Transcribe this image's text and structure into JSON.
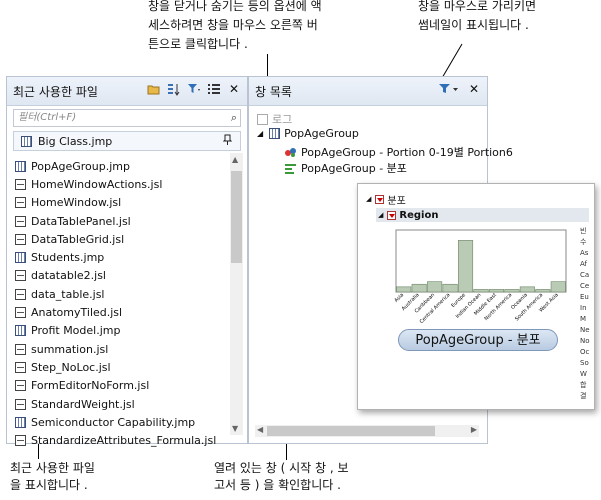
{
  "callouts": {
    "top_left": [
      "창을 닫거나 숨기는 등의 옵션에 액",
      "세스하려면 창을 마우스 오른쪽 버",
      "튼으로 클릭합니다 ."
    ],
    "top_right": [
      "창을 마우스로 가리키면",
      "썸네일이 표시됩니다 ."
    ],
    "bottom_left": [
      "최근 사용한 파일",
      "을 표시합니다 ."
    ],
    "bottom_right": [
      "열려 있는 창 ( 시작 창 , 보",
      "고서 등 ) 을 확인합니다 ."
    ]
  },
  "recent_files": {
    "title": "최근 사용한 파일",
    "header_icons": [
      "open-folder-icon",
      "sort-icon",
      "filter-icon",
      "list-view-icon",
      "close-icon"
    ],
    "filter_placeholder": "필터(Ctrl+F)",
    "pinned": {
      "name": "Big Class.jmp",
      "type": "jmp"
    },
    "files": [
      {
        "name": "PopAgeGroup.jmp",
        "type": "jmp"
      },
      {
        "name": "HomeWindowActions.jsl",
        "type": "jsl"
      },
      {
        "name": "HomeWindow.jsl",
        "type": "jsl"
      },
      {
        "name": "DataTablePanel.jsl",
        "type": "jsl"
      },
      {
        "name": "DataTableGrid.jsl",
        "type": "jsl"
      },
      {
        "name": "Students.jmp",
        "type": "jmp"
      },
      {
        "name": "datatable2.jsl",
        "type": "jsl"
      },
      {
        "name": "data_table.jsl",
        "type": "jsl"
      },
      {
        "name": "AnatomyTiled.jsl",
        "type": "jsl"
      },
      {
        "name": "Profit Model.jmp",
        "type": "jmp"
      },
      {
        "name": "summation.jsl",
        "type": "jsl"
      },
      {
        "name": "Step_NoLoc.jsl",
        "type": "jsl"
      },
      {
        "name": "FormEditorNoForm.jsl",
        "type": "jsl"
      },
      {
        "name": "StandardWeight.jsl",
        "type": "jsl"
      },
      {
        "name": "Semiconductor Capability.jmp",
        "type": "jmp"
      },
      {
        "name": "StandardizeAttributes_Formula.jsl",
        "type": "jsl"
      }
    ]
  },
  "window_list": {
    "title": "창 목록",
    "header_icons": [
      "filter-icon",
      "close-icon"
    ],
    "tree": {
      "log": "로그",
      "group": "PopAgeGroup",
      "children": [
        "PopAgeGroup - Portion 0-19별 Portion6",
        "PopAgeGroup - 분포"
      ]
    }
  },
  "thumbnail": {
    "header": "분포",
    "sub_header": "Region",
    "tooltip": "PopAgeGroup - 분포",
    "side_glyphs": "빈 수 As Af Ca Ce Eu In M Ne No Oc So W 합 결"
  },
  "chart_data": {
    "type": "bar",
    "categories": [
      "Asia",
      "Australia",
      "Caribbean",
      "Central America",
      "Europe",
      "Indian Ocean",
      "Middle East",
      "North America",
      "Oceania",
      "South America",
      "West Asia"
    ],
    "values": [
      2,
      3,
      4,
      3,
      20,
      1,
      1,
      1,
      2,
      1,
      4
    ],
    "ylim": [
      0,
      24
    ],
    "grid": false,
    "colors": {
      "bar": "#b9cbb4",
      "bar_stroke": "#6f8668"
    }
  }
}
